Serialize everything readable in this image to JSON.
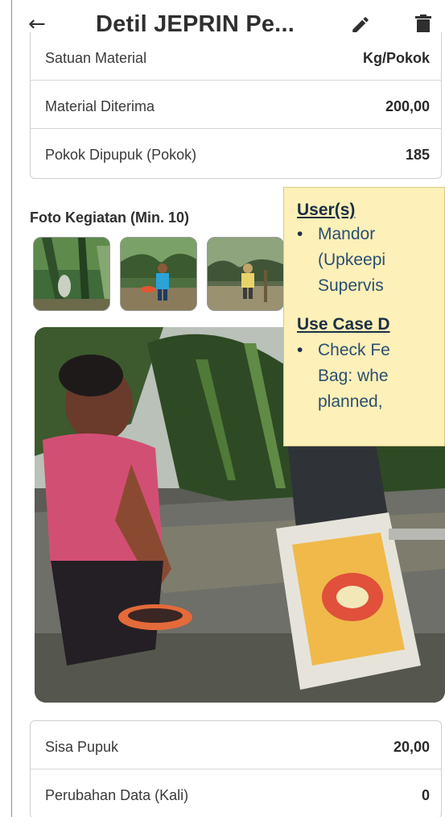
{
  "app": {
    "title": "Detil JEPRIN Pe...",
    "back_icon": "arrow-left-icon",
    "edit_icon": "pencil-icon",
    "delete_icon": "trash-icon"
  },
  "details_top": [
    {
      "label": "Satuan Material",
      "value": "Kg/Pokok"
    },
    {
      "label": "Material Diterima",
      "value": "200,00"
    },
    {
      "label": "Pokok Dipupuk (Pokok)",
      "value": "185"
    }
  ],
  "photos": {
    "section_label": "Foto Kegiatan (Min. 10)",
    "thumbnail_count_visible": 3
  },
  "details_bottom": [
    {
      "label": "Sisa Pupuk",
      "value": "20,00"
    },
    {
      "label": "Perubahan Data (Kali)",
      "value": "0"
    }
  ],
  "callout": {
    "users_heading": "User(s)",
    "users_bullet": "•",
    "users_lines": [
      "Mandor",
      "(Upkeepi",
      "Supervis"
    ],
    "usecase_heading": "Use Case D",
    "usecase_bullet": "•",
    "usecase_lines": [
      "Check Fe",
      "Bag: whe",
      "planned,"
    ]
  },
  "colors": {
    "callout_bg": "#fdf0b8",
    "callout_text": "#1d2f45",
    "card_border": "#cfcfcf"
  }
}
